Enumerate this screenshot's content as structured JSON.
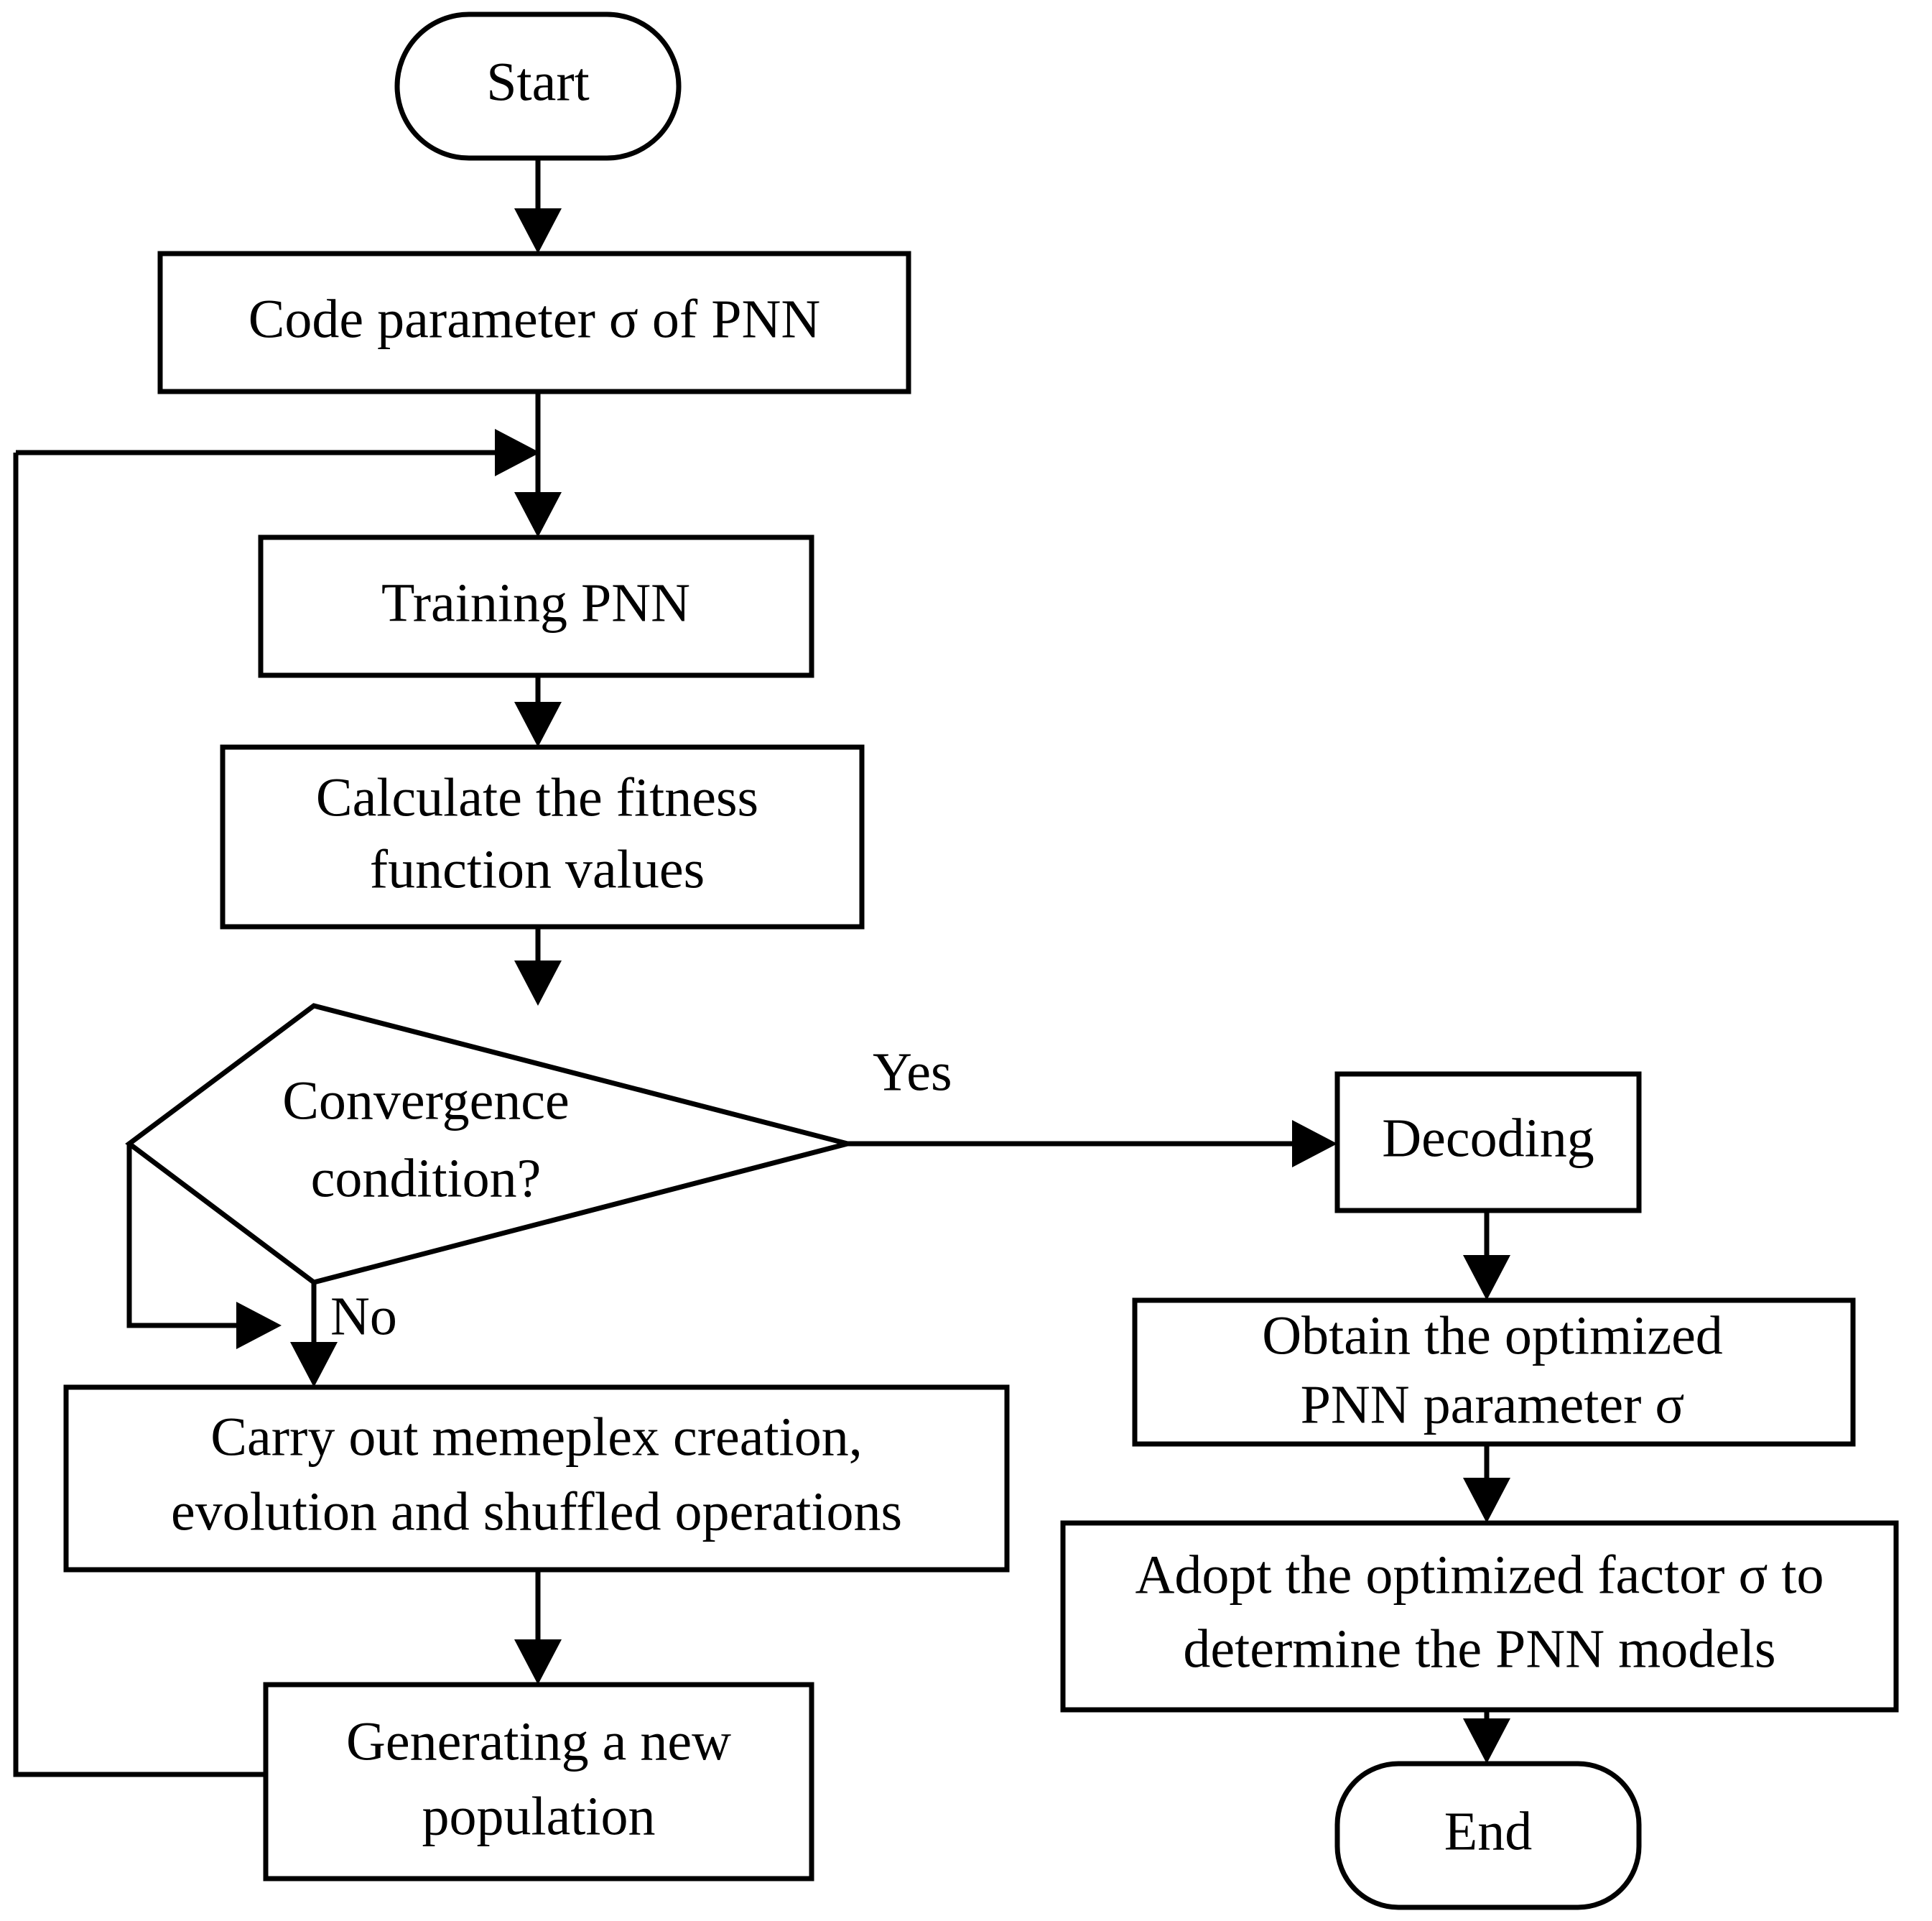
{
  "diagram": {
    "title": "PNN parameter optimization flowchart",
    "type": "flowchart",
    "background_color": "#ffffff",
    "line_color": "#000000",
    "text_color": "#000000"
  },
  "nodes": {
    "start": {
      "label": "Start",
      "shape": "terminator"
    },
    "code_parameter": {
      "label": "Code parameter σ of PNN",
      "shape": "process"
    },
    "training_pnn": {
      "label": "Training PNN",
      "shape": "process"
    },
    "calculate_fitness_line1": {
      "label": "Calculate the fitness",
      "shape": "process"
    },
    "calculate_fitness_line2": {
      "label": "function values",
      "shape": "process"
    },
    "convergence_line1": {
      "label": "Convergence",
      "shape": "decision"
    },
    "convergence_line2": {
      "label": "condition?",
      "shape": "decision"
    },
    "memeplex_line1": {
      "label": "Carry out memeplex creation,",
      "shape": "process"
    },
    "memeplex_line2": {
      "label": "evolution and shuffled operations",
      "shape": "process"
    },
    "new_population_line1": {
      "label": "Generating a new",
      "shape": "process"
    },
    "new_population_line2": {
      "label": "population",
      "shape": "process"
    },
    "decoding": {
      "label": "Decoding",
      "shape": "process"
    },
    "obtain_optimized_line1": {
      "label": "Obtain the optimized",
      "shape": "process"
    },
    "obtain_optimized_line2": {
      "label": "PNN parameter σ",
      "shape": "process"
    },
    "adopt_optimized_line1": {
      "label": "Adopt the optimized factor σ to",
      "shape": "process"
    },
    "adopt_optimized_line2": {
      "label": "determine the PNN models",
      "shape": "process"
    },
    "end": {
      "label": "End",
      "shape": "terminator"
    }
  },
  "edge_labels": {
    "yes": "Yes",
    "no": "No"
  }
}
